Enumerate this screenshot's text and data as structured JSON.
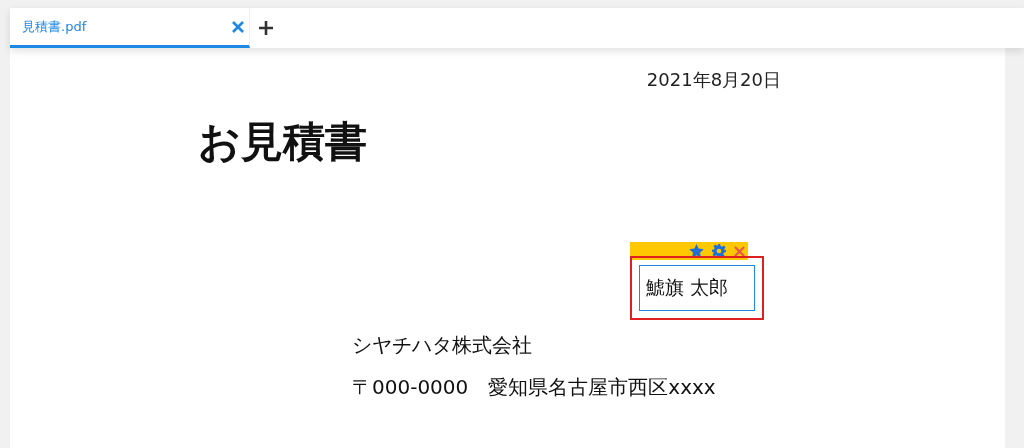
{
  "tabs": [
    {
      "label": "見積書.pdf",
      "selected": true
    }
  ],
  "document": {
    "date": "2021年8月20日",
    "title": "お見積書",
    "signature_field": {
      "value": "鯱旗 太郎",
      "selected": true
    },
    "company": "シヤチハタ株式会社",
    "address": "〒000-0000　愛知県名古屋市西区xxxx"
  }
}
